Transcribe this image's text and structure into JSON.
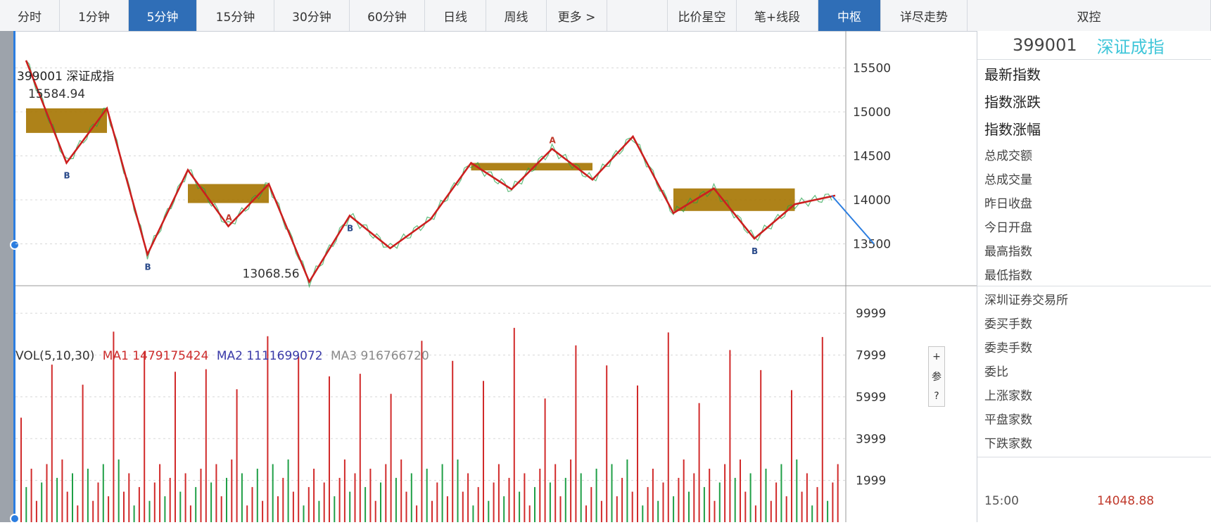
{
  "tabs": [
    {
      "label": "分时"
    },
    {
      "label": "1分钟"
    },
    {
      "label": "5分钟",
      "active": true
    },
    {
      "label": "15分钟"
    },
    {
      "label": "30分钟"
    },
    {
      "label": "60分钟"
    },
    {
      "label": "日线"
    },
    {
      "label": "周线"
    },
    {
      "label": "更多 >"
    },
    {
      "label": ""
    },
    {
      "label": "比价星空"
    },
    {
      "label": "笔+线段"
    },
    {
      "label": "中枢",
      "active": true
    },
    {
      "label": "详尽走势"
    },
    {
      "label": "双控"
    }
  ],
  "chart": {
    "symbol_title": "399001 深证成指",
    "high_label": "15584.94",
    "low_label": "13068.56",
    "price_axis": [
      "15500",
      "15000",
      "14500",
      "14000",
      "13500"
    ],
    "vol_axis": [
      "9999",
      "7999",
      "5999",
      "3999",
      "1999"
    ],
    "signal_labels": [
      "A",
      "B"
    ],
    "vol_indicator": {
      "name": "VOL(5,10,30)",
      "ma1": "MA1 1479175424",
      "ma2": "MA2 1111699072",
      "ma3": "MA3 916766720"
    },
    "vol_buttons": [
      "+",
      "参",
      "?"
    ],
    "colors": {
      "up": "#d12a2a",
      "down": "#1f9f46",
      "stroke": "#cc1f1f",
      "box": "#a57400",
      "box_blue": "#1b4f9b",
      "accent": "#2f6eb7"
    }
  },
  "chart_data": {
    "type": "line",
    "title": "399001 深证成指",
    "ylim": [
      13000,
      15600
    ],
    "strokes": [
      15584.94,
      14420,
      15040,
      13380,
      14340,
      13700,
      14180,
      13068.56,
      13820,
      13450,
      13780,
      14420,
      14120,
      14580,
      14230,
      14720,
      13850,
      14130,
      13560,
      13950,
      14048.88
    ],
    "annotations": {
      "high": 15584.94,
      "low": 13068.56
    },
    "volume_ylim": [
      0,
      10000
    ]
  },
  "panel": {
    "code": "399001",
    "name": "深证成指",
    "rows_main": [
      "最新指数",
      "指数涨跌",
      "指数涨幅"
    ],
    "rows_sub": [
      "总成交额",
      "总成交量",
      "昨日收盘",
      "今日开盘",
      "最高指数",
      "最低指数"
    ],
    "rows_ex": [
      "深圳证券交易所",
      "委买手数",
      "委卖手数",
      "委比",
      "上涨家数",
      "平盘家数",
      "下跌家数"
    ],
    "tick_time": "15:00",
    "tick_value": "14048.88"
  }
}
